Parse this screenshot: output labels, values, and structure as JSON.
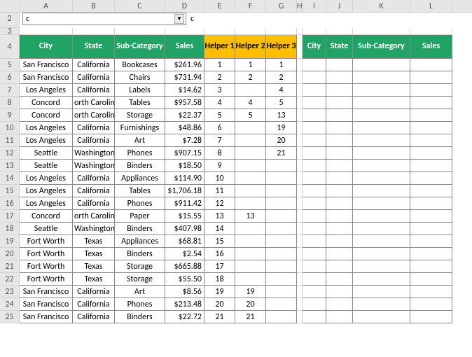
{
  "cols": [
    "A",
    "B",
    "C",
    "D",
    "E",
    "F",
    "G",
    "H",
    "I",
    "J",
    "K",
    "L"
  ],
  "dropdown": {
    "value": "c",
    "label": "c"
  },
  "headers_left": {
    "A": "City",
    "B": "State",
    "C": "Sub-Category",
    "D": "Sales",
    "E": "Helper 1",
    "F": "Helper 2",
    "G": "Helper 3"
  },
  "headers_right": {
    "I": "City",
    "J": "State",
    "K": "Sub-Category",
    "L": "Sales"
  },
  "chart_data": {
    "type": "table",
    "columns": [
      "City",
      "State",
      "Sub-Category",
      "Sales",
      "Helper 1",
      "Helper 2",
      "Helper 3"
    ],
    "rows": [
      {
        "row": 5,
        "City": "San Francisco",
        "State": "California",
        "Sub-Category": "Bookcases",
        "Sales": "$261.96",
        "Helper 1": "1",
        "Helper 2": "1",
        "Helper 3": "1"
      },
      {
        "row": 6,
        "City": "San Francisco",
        "State": "California",
        "Sub-Category": "Chairs",
        "Sales": "$731.94",
        "Helper 1": "2",
        "Helper 2": "2",
        "Helper 3": "2"
      },
      {
        "row": 7,
        "City": "Los Angeles",
        "State": "California",
        "Sub-Category": "Labels",
        "Sales": "$14.62",
        "Helper 1": "3",
        "Helper 2": "",
        "Helper 3": "4"
      },
      {
        "row": 8,
        "City": "Concord",
        "State": "orth Carolin",
        "Sub-Category": "Tables",
        "Sales": "$957.58",
        "Helper 1": "4",
        "Helper 2": "4",
        "Helper 3": "5"
      },
      {
        "row": 9,
        "City": "Concord",
        "State": "orth Carolin",
        "Sub-Category": "Storage",
        "Sales": "$22.37",
        "Helper 1": "5",
        "Helper 2": "5",
        "Helper 3": "13"
      },
      {
        "row": 10,
        "City": "Los Angeles",
        "State": "California",
        "Sub-Category": "Furnishings",
        "Sales": "$48.86",
        "Helper 1": "6",
        "Helper 2": "",
        "Helper 3": "19"
      },
      {
        "row": 11,
        "City": "Los Angeles",
        "State": "California",
        "Sub-Category": "Art",
        "Sales": "$7.28",
        "Helper 1": "7",
        "Helper 2": "",
        "Helper 3": "20"
      },
      {
        "row": 12,
        "City": "Seattle",
        "State": "Washington",
        "Sub-Category": "Phones",
        "Sales": "$907.15",
        "Helper 1": "8",
        "Helper 2": "",
        "Helper 3": "21"
      },
      {
        "row": 13,
        "City": "Seattle",
        "State": "Washington",
        "Sub-Category": "Binders",
        "Sales": "$18.50",
        "Helper 1": "9",
        "Helper 2": "",
        "Helper 3": ""
      },
      {
        "row": 14,
        "City": "Los Angeles",
        "State": "California",
        "Sub-Category": "Appliances",
        "Sales": "$114.90",
        "Helper 1": "10",
        "Helper 2": "",
        "Helper 3": ""
      },
      {
        "row": 15,
        "City": "Los Angeles",
        "State": "California",
        "Sub-Category": "Tables",
        "Sales": "$1,706.18",
        "Helper 1": "11",
        "Helper 2": "",
        "Helper 3": ""
      },
      {
        "row": 16,
        "City": "Los Angeles",
        "State": "California",
        "Sub-Category": "Phones",
        "Sales": "$911.42",
        "Helper 1": "12",
        "Helper 2": "",
        "Helper 3": ""
      },
      {
        "row": 17,
        "City": "Concord",
        "State": "orth Carolin",
        "Sub-Category": "Paper",
        "Sales": "$15.55",
        "Helper 1": "13",
        "Helper 2": "13",
        "Helper 3": ""
      },
      {
        "row": 18,
        "City": "Seattle",
        "State": "Washington",
        "Sub-Category": "Binders",
        "Sales": "$407.98",
        "Helper 1": "14",
        "Helper 2": "",
        "Helper 3": ""
      },
      {
        "row": 19,
        "City": "Fort Worth",
        "State": "Texas",
        "Sub-Category": "Appliances",
        "Sales": "$68.81",
        "Helper 1": "15",
        "Helper 2": "",
        "Helper 3": ""
      },
      {
        "row": 20,
        "City": "Fort Worth",
        "State": "Texas",
        "Sub-Category": "Binders",
        "Sales": "$2.54",
        "Helper 1": "16",
        "Helper 2": "",
        "Helper 3": ""
      },
      {
        "row": 21,
        "City": "Fort Worth",
        "State": "Texas",
        "Sub-Category": "Storage",
        "Sales": "$665.88",
        "Helper 1": "17",
        "Helper 2": "",
        "Helper 3": ""
      },
      {
        "row": 22,
        "City": "Fort Worth",
        "State": "Texas",
        "Sub-Category": "Storage",
        "Sales": "$55.50",
        "Helper 1": "18",
        "Helper 2": "",
        "Helper 3": ""
      },
      {
        "row": 23,
        "City": "San Francisco",
        "State": "California",
        "Sub-Category": "Art",
        "Sales": "$8.56",
        "Helper 1": "19",
        "Helper 2": "19",
        "Helper 3": ""
      },
      {
        "row": 24,
        "City": "San Francisco",
        "State": "California",
        "Sub-Category": "Phones",
        "Sales": "$213.48",
        "Helper 1": "20",
        "Helper 2": "20",
        "Helper 3": ""
      },
      {
        "row": 25,
        "City": "San Francisco",
        "State": "California",
        "Sub-Category": "Binders",
        "Sales": "$22.72",
        "Helper 1": "21",
        "Helper 2": "21",
        "Helper 3": ""
      }
    ]
  }
}
